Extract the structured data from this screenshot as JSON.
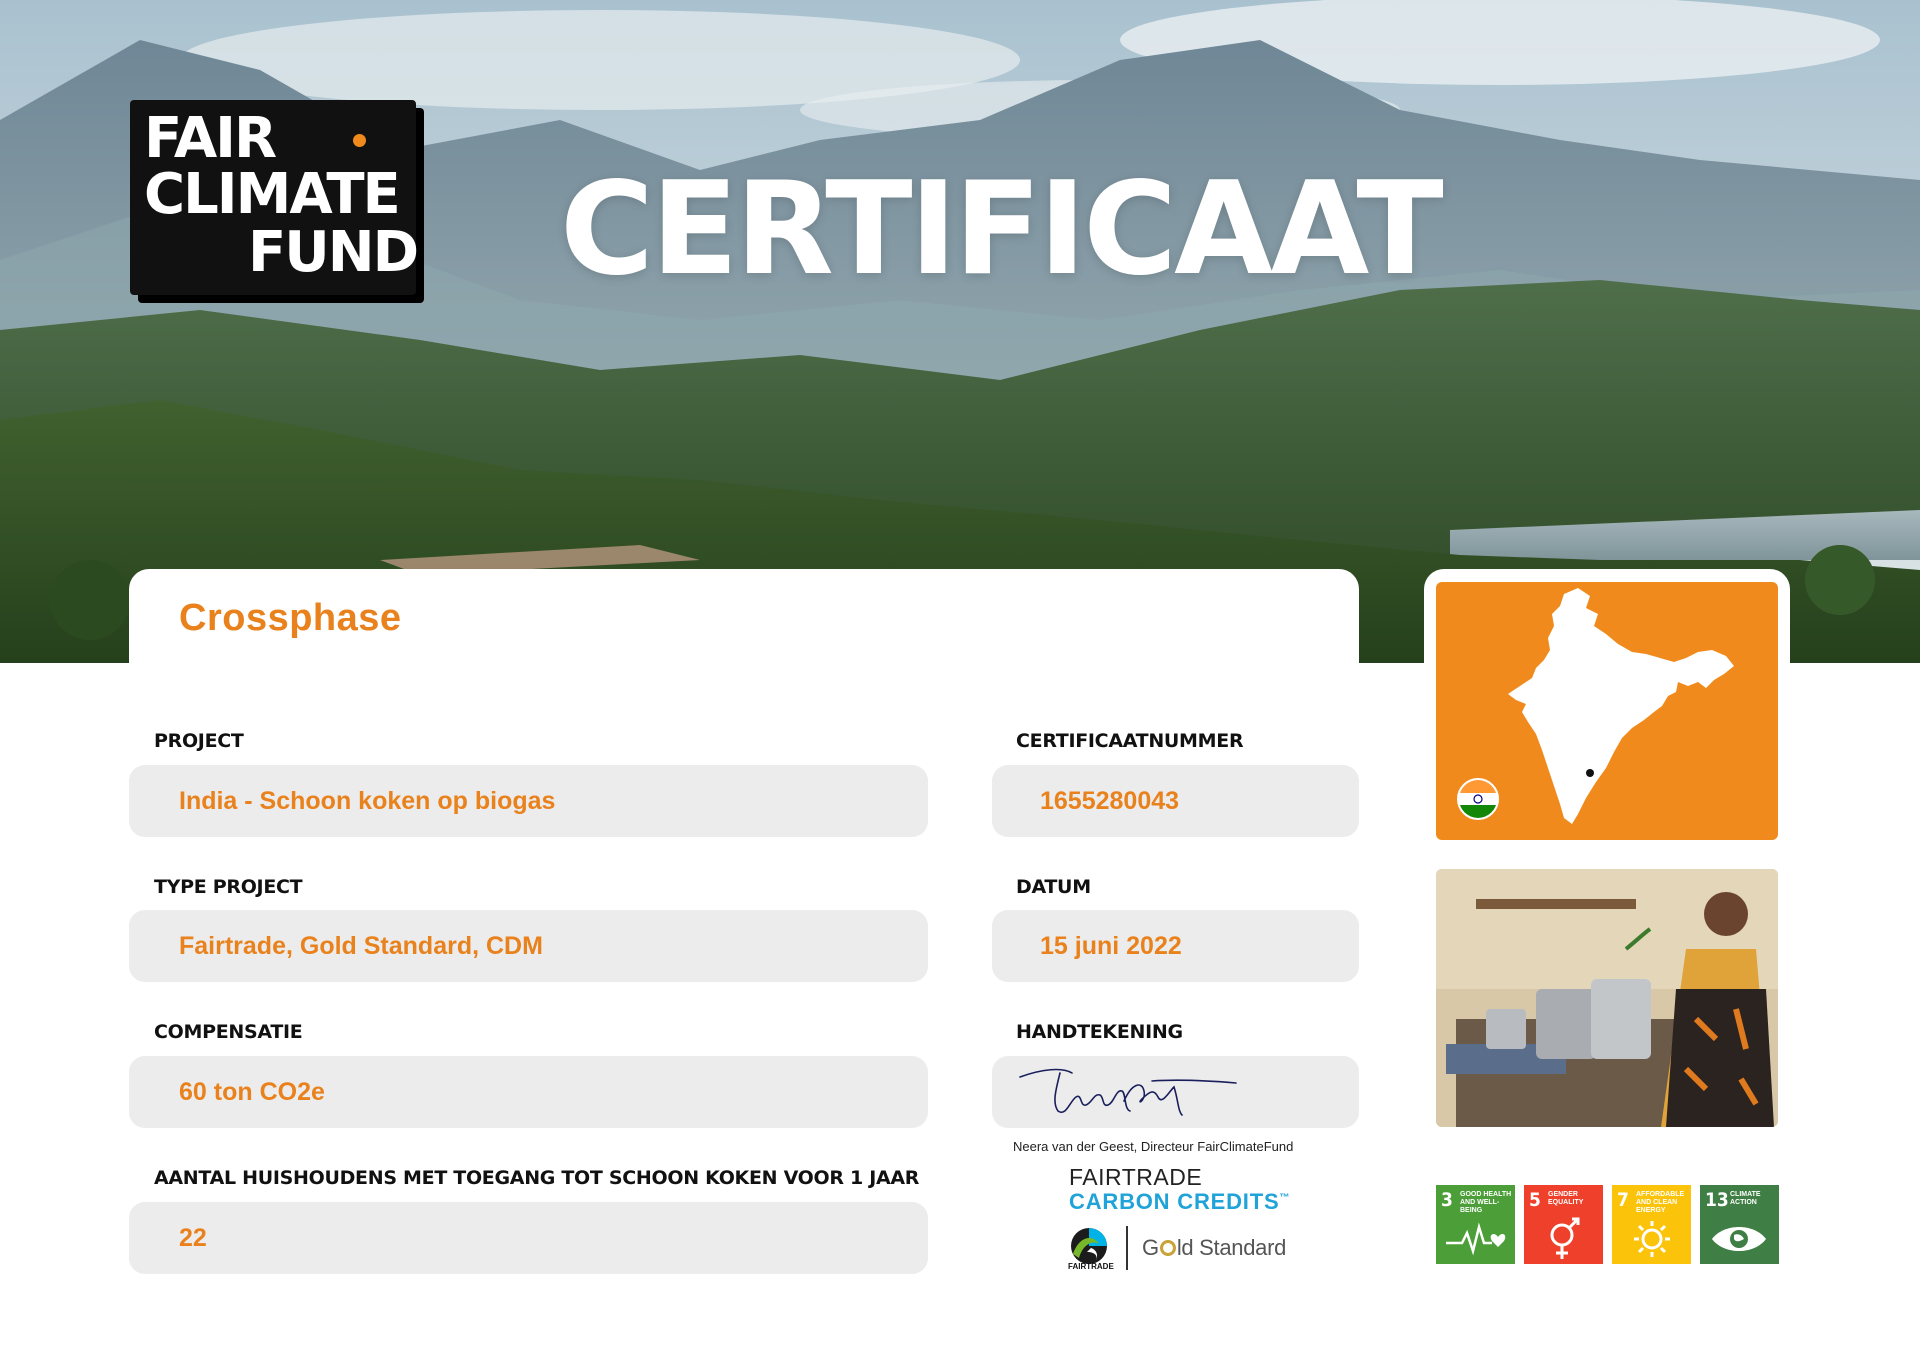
{
  "logo": {
    "line1": "FAIR",
    "line2": "CLIMATE",
    "line3": "FUND"
  },
  "hero_title": "CERTIFICAAT",
  "donor": "Crossphase",
  "fields": {
    "project": {
      "label": "PROJECT",
      "value": "India - Schoon koken op biogas"
    },
    "type_project": {
      "label": "TYPE PROJECT",
      "value": "Fairtrade, Gold Standard, CDM"
    },
    "compensatie": {
      "label": "COMPENSATIE",
      "value": "60 ton CO2e"
    },
    "huishoudens": {
      "label": "AANTAL HUISHOUDENS MET TOEGANG TOT SCHOON KOKEN VOOR 1 JAAR",
      "value": "22"
    },
    "certificaatnummer": {
      "label": "CERTIFICAATNUMMER",
      "value": "1655280043"
    },
    "datum": {
      "label": "DATUM",
      "value": "15 juni 2022"
    },
    "handtekening": {
      "label": "HANDTEKENING",
      "caption": "Neera van der Geest, Directeur FairClimateFund"
    }
  },
  "fairtrade": {
    "title": "FAIRTRADE",
    "subtitle": "CARBON CREDITS",
    "tm": "™",
    "small": "FAIRTRADE",
    "gold_prefix": "G",
    "gold_suffix": "ld Standard"
  },
  "sdgs": [
    {
      "number": "3",
      "text": "Good health and well-being",
      "color": "#4c9f38",
      "icon": "heartbeat-icon"
    },
    {
      "number": "5",
      "text": "Gender equality",
      "color": "#ef402b",
      "icon": "gender-icon"
    },
    {
      "number": "7",
      "text": "Affordable and clean energy",
      "color": "#fcc30b",
      "icon": "sun-icon"
    },
    {
      "number": "13",
      "text": "Climate action",
      "color": "#3f7e44",
      "icon": "eye-globe-icon"
    }
  ],
  "colors": {
    "accent": "#e9821c",
    "map_bg": "#f08a1c",
    "field_bg": "#ececec"
  }
}
